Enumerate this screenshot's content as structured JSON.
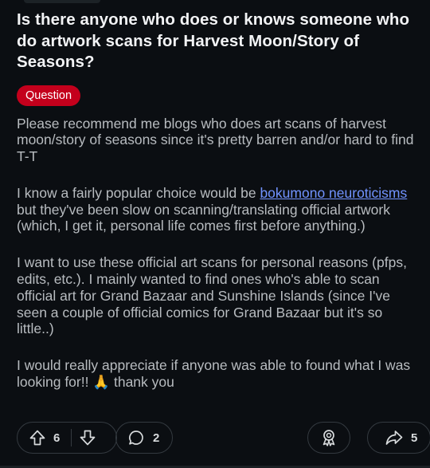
{
  "post": {
    "title": "Is there anyone who does or knows someone who do artwork scans for Harvest Moon/Story of Seasons?",
    "flair": "Question",
    "body": {
      "p1": "Please recommend me blogs who does art scans of harvest moon/story of seasons since it's pretty barren and/or hard to find T-T",
      "p2_before": "I know a fairly popular choice would be ",
      "p2_link": "bokumono neuroticisms",
      "p2_after": " but they've been slow on scanning/translating official artwork (which, I get it, personal life comes first before anything.)",
      "p3": "I want to use these official art scans for personal reasons (pfps, edits, etc.). I mainly wanted to find ones who's able to scan official art for Grand Bazaar and Sunshine Islands (since I've seen a couple of official comics for Grand Bazaar but it's so little..)",
      "p4": "I would really appreciate if anyone was able to found what I was looking for!! 🙏 thank you"
    }
  },
  "actions": {
    "upvotes": "6",
    "comments": "2",
    "shares": "5"
  },
  "icons": {
    "upvote": "upvote-arrow-icon",
    "downvote": "downvote-arrow-icon",
    "comment": "comment-bubble-icon",
    "award": "award-icon",
    "share": "share-arrow-icon"
  },
  "colors": {
    "background": "#0b0e12",
    "title": "#f2f3f5",
    "body_text": "#b8bcc0",
    "flair_bg": "#c4001c",
    "link": "#7193ff",
    "pill_border": "#343a40"
  }
}
